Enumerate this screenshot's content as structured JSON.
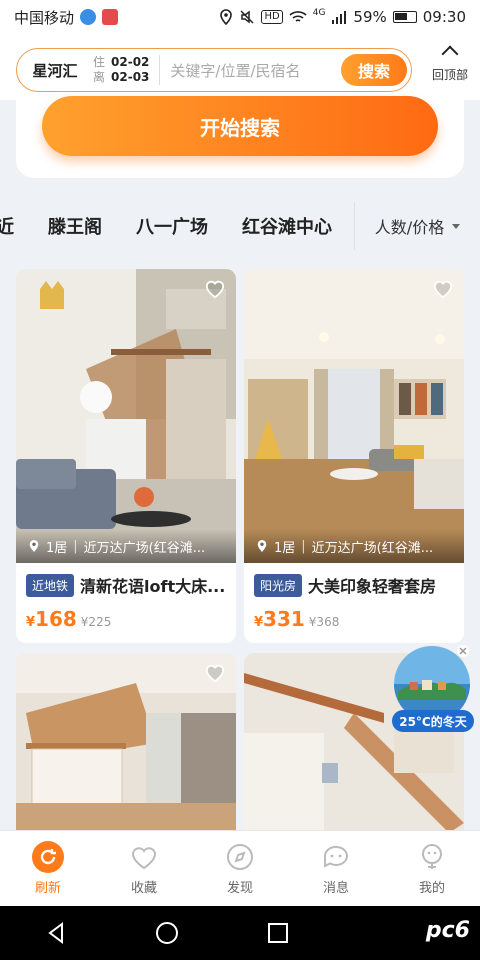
{
  "status_bar": {
    "carrier": "中国移动",
    "network": "4G",
    "hd": "HD",
    "battery": "59%",
    "time": "09:30"
  },
  "search": {
    "city": "星河汇",
    "checkin_label": "住",
    "checkin_date": "02-02",
    "checkout_label": "离",
    "checkout_date": "02-03",
    "placeholder": "关键字/位置/民宿名",
    "search_button": "搜索"
  },
  "back_to_top": "回顶部",
  "start_search_button": "开始搜索",
  "location_tags": [
    "近",
    "滕王阁",
    "八一广场",
    "红谷滩中心"
  ],
  "filter": {
    "label": "人数/价格"
  },
  "listings": [
    {
      "rooms": "1居",
      "location": "近万达广场(红谷滩...",
      "badge": "近地铁",
      "title": "清新花语loft大床...",
      "price_currency": "¥",
      "price": "168",
      "original_price": "¥225"
    },
    {
      "rooms": "1居",
      "location": "近万达广场(红谷滩...",
      "badge": "阳光房",
      "title": "大美印象轻奢套房",
      "price_currency": "¥",
      "price": "331",
      "original_price": "¥368"
    }
  ],
  "promo": {
    "text": "25°C的冬天"
  },
  "tabs": [
    {
      "label": "刷新",
      "icon": "refresh-icon",
      "active": true
    },
    {
      "label": "收藏",
      "icon": "heart-icon",
      "active": false
    },
    {
      "label": "发现",
      "icon": "compass-icon",
      "active": false
    },
    {
      "label": "消息",
      "icon": "chat-icon",
      "active": false
    },
    {
      "label": "我的",
      "icon": "user-icon",
      "active": false
    }
  ],
  "watermark": "pc6",
  "colors": {
    "accent": "#ff7a1a",
    "badge": "#3d5b9a"
  }
}
